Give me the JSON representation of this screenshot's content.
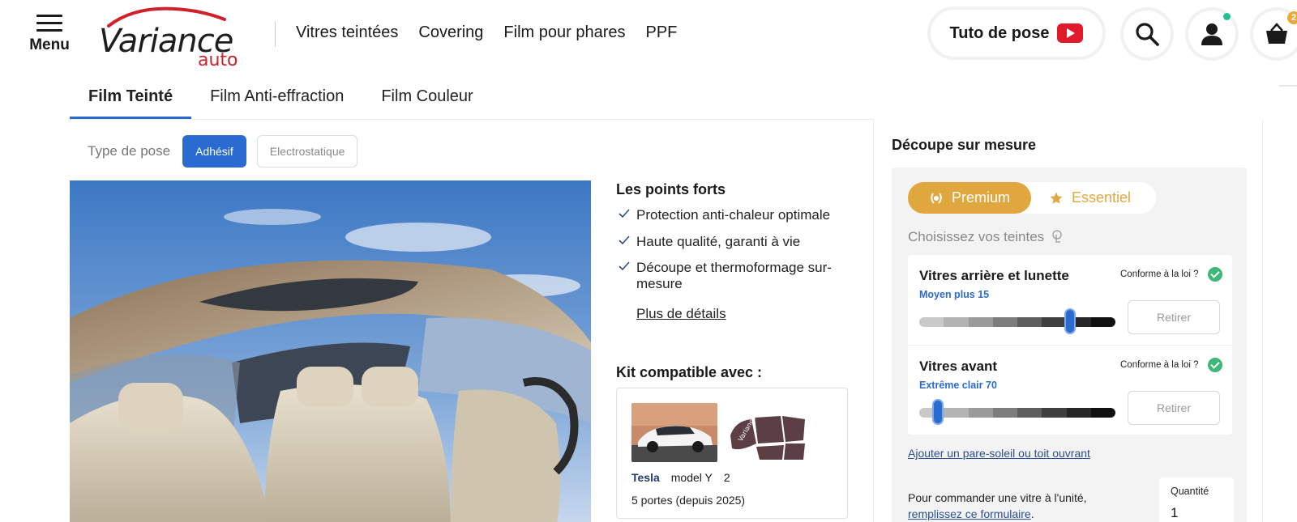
{
  "header": {
    "menu_label": "Menu",
    "logo_text": "Variance",
    "logo_sub": "auto",
    "nav": [
      "Vitres teintées",
      "Covering",
      "Film pour phares",
      "PPF"
    ],
    "tuto_label": "Tuto de pose",
    "cart_count": "2",
    "icons": [
      "menu-icon",
      "youtube-icon",
      "search-icon",
      "user-icon",
      "basket-icon"
    ]
  },
  "tabs": [
    "Film Teinté",
    "Film Anti-effraction",
    "Film Couleur"
  ],
  "pose": {
    "label": "Type de pose",
    "options": [
      "Adhésif",
      "Electrostatique"
    ],
    "selected": "Adhésif"
  },
  "points": {
    "title": "Les points forts",
    "items": [
      "Protection anti-chaleur optimale",
      "Haute qualité, garanti à vie",
      "Découpe et thermoformage sur-mesure"
    ],
    "more": "Plus de détails"
  },
  "kit": {
    "title": "Kit compatible avec :",
    "brand": "Tesla",
    "model": "model Y",
    "doors_count": "2",
    "variant": "5 portes (depuis 2025)",
    "pattern_watermark": "Variance"
  },
  "custom": {
    "title": "Découpe sur mesure",
    "ranges": [
      "Premium",
      "Essentiel"
    ],
    "selected_range": "Premium",
    "choose_label": "Choisissez vos teintes",
    "windows": [
      {
        "name": "Vitres arrière et lunette",
        "level": "Moyen plus 15",
        "law": "Conforme à la loi ?",
        "remove": "Retirer",
        "slider_fraction": 0.75
      },
      {
        "name": "Vitres avant",
        "level": "Extrême clair 70",
        "law": "Conforme à la loi ?",
        "remove": "Retirer",
        "slider_fraction": 0.08
      }
    ],
    "add_link": "Ajouter un pare-soleil ou toit ouvrant",
    "unit_text": "Pour commander une vitre à l'unité,",
    "unit_link": "remplissez ce formulaire",
    "unit_period": ".",
    "qty_label": "Quantité",
    "qty_value": "1"
  },
  "colors": {
    "accent_blue": "#2a6bd1",
    "premium_gold": "#e0a73e",
    "brand_red": "#d0202a",
    "ok_green": "#3cb878"
  }
}
